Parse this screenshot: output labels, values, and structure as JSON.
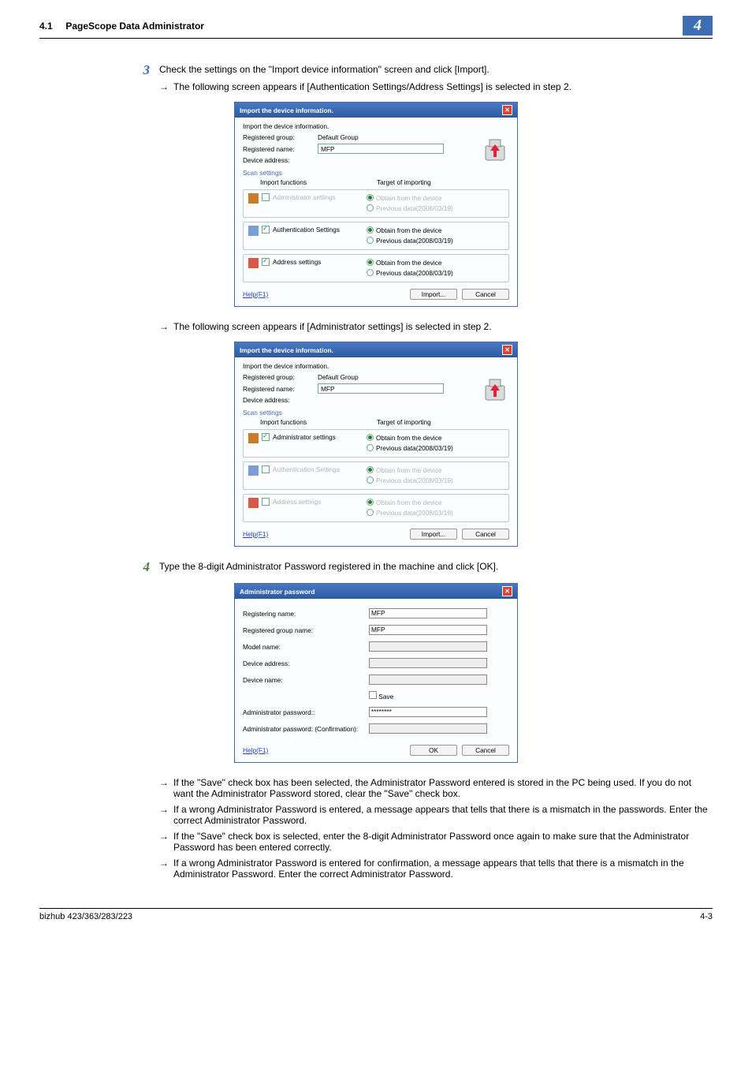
{
  "header": {
    "section_no": "4.1",
    "section_title": "PageScope Data Administrator",
    "chapter": "4"
  },
  "step3": {
    "num": "3",
    "text": "Check the settings on the \"Import device information\" screen and click [Import].",
    "bullet1": "The following screen appears if [Authentication Settings/Address Settings] is selected in step 2.",
    "bullet2": "The following screen appears if [Administrator settings] is selected in step 2."
  },
  "dlg1": {
    "title": "Import the device information.",
    "subtitle": "Import the device information.",
    "reg_group_lbl": "Registered group:",
    "reg_group_val": "Default Group",
    "reg_name_lbl": "Registered name:",
    "reg_name_val": "MFP",
    "dev_addr_lbl": "Device address:",
    "scan_title": "Scan settings",
    "col_func": "Import functions",
    "col_target": "Target of importing",
    "row_admin": "Administrator settings",
    "row_auth": "Authentication Settings",
    "row_addr": "Address settings",
    "opt_obtain": "Obtain from the device",
    "opt_prev": "Previous data(2008/03/19)",
    "help": "Help(F1)",
    "import_btn": "Import...",
    "cancel_btn": "Cancel"
  },
  "dlg2": {
    "title": "Import the device information.",
    "subtitle": "Import the device information.",
    "reg_group_lbl": "Registered group:",
    "reg_group_val": "Default Group",
    "reg_name_lbl": "Registered name:",
    "reg_name_val": "MFP",
    "dev_addr_lbl": "Device address:",
    "scan_title": "Scan settings",
    "col_func": "Import functions",
    "col_target": "Target of importing",
    "row_admin": "Administrator settings",
    "row_auth": "Authentication Settings",
    "row_addr": "Address settings",
    "opt_obtain": "Obtain from the device",
    "opt_prev": "Previous data(2008/03/19)",
    "help": "Help(F1)",
    "import_btn": "Import...",
    "cancel_btn": "Cancel"
  },
  "step4": {
    "num": "4",
    "text": "Type the 8-digit Administrator Password registered in the machine and click [OK].",
    "b1": "If the \"Save\" check box has been selected, the Administrator Password entered is stored in the PC being used. If you do not want the Administrator Password stored, clear the \"Save\" check box.",
    "b2": "If a wrong Administrator Password is entered, a message appears that tells that there is a mismatch in the passwords. Enter the correct Administrator Password.",
    "b3": "If the \"Save\" check box is selected, enter the 8-digit Administrator Password once again to make sure that the Administrator Password has been entered correctly.",
    "b4": "If a wrong Administrator Password is entered for confirmation, a message appears that tells that there is a mismatch in the Administrator Password. Enter the correct Administrator Password."
  },
  "dlg3": {
    "title": "Administrator password",
    "reg_name_lbl": "Registering name:",
    "reg_name_val": "MFP",
    "reg_group_lbl": "Registered group name:",
    "reg_group_val": "MFP",
    "model_lbl": "Model name:",
    "dev_addr_lbl": "Device address:",
    "dev_name_lbl": "Device name:",
    "save_lbl": "Save",
    "admin_pwd_lbl": "Administrator password::",
    "admin_pwd_val": "********",
    "admin_pwd_conf_lbl": "Administrator password: (Confirmation):",
    "help": "Help(F1)",
    "ok_btn": "OK",
    "cancel_btn": "Cancel"
  },
  "footer": {
    "model": "bizhub 423/363/283/223",
    "page": "4-3"
  }
}
